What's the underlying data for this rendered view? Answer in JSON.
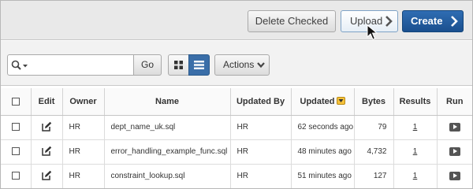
{
  "header": {
    "delete_checked_label": "Delete Checked",
    "upload_label": "Upload",
    "create_label": "Create"
  },
  "toolbar": {
    "search_value": "",
    "go_label": "Go",
    "actions_label": "Actions",
    "active_view": "report"
  },
  "table": {
    "columns": [
      "Edit",
      "Owner",
      "Name",
      "Updated By",
      "Updated",
      "Bytes",
      "Results",
      "Run"
    ],
    "sort_column": "Updated",
    "rows": [
      {
        "owner": "HR",
        "name": "dept_name_uk.sql",
        "updated_by": "HR",
        "updated": "62 seconds ago",
        "bytes": "79",
        "results": "1"
      },
      {
        "owner": "HR",
        "name": "error_handling_example_func.sql",
        "updated_by": "HR",
        "updated": "48 minutes ago",
        "bytes": "4,732",
        "results": "1"
      },
      {
        "owner": "HR",
        "name": "constraint_lookup.sql",
        "updated_by": "HR",
        "updated": "51 minutes ago",
        "bytes": "127",
        "results": "1"
      }
    ]
  },
  "colors": {
    "create_button": "#1f5797",
    "active_view_button": "#3a6ea8",
    "sort_badge": "#f6c23b",
    "toolbar_background": "#e9e9e9"
  }
}
